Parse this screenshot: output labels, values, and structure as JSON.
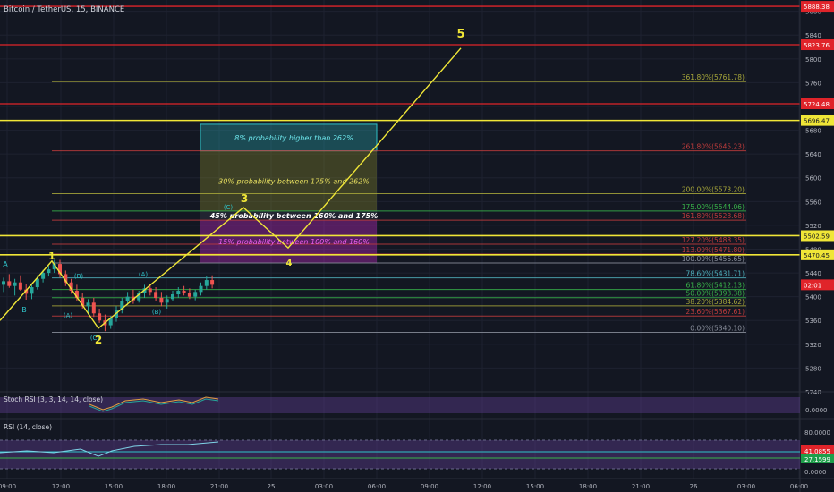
{
  "header": {
    "symbol_title": "Bitcoin / TetherUS, 15, BINANCE"
  },
  "colors": {
    "background": "#131722",
    "grid": "#1e2230",
    "yellow": "#f0e637",
    "red": "#e0242a",
    "green": "#35c25b",
    "candle_up": "#26a69a",
    "candle_down": "#ef5350",
    "magenta": "#d12bd1",
    "purple_band": "#3a2a5e",
    "cyan": "#2fc3c9",
    "olive": "#8b8b2b"
  },
  "chart_data": [
    {
      "type": "candlestick",
      "title": "Bitcoin / TetherUS, 15, BINANCE",
      "xlabel": "",
      "ylabel": "",
      "ylim": [
        5240,
        5890
      ],
      "x_ticks": [
        "09:00",
        "12:00",
        "15:00",
        "18:00",
        "21:00",
        "25",
        "03:00",
        "06:00",
        "09:00",
        "12:00",
        "15:00",
        "18:00",
        "21:00",
        "26",
        "03:00",
        "06:00"
      ],
      "y_ticks": [
        5240,
        5280,
        5320,
        5360,
        5400,
        5440,
        5480,
        5520,
        5560,
        5600,
        5640,
        5680,
        5720,
        5760,
        5800,
        5840,
        5880
      ],
      "price_labels": [
        {
          "text": "5888.38",
          "value": 5888.38,
          "color": "red"
        },
        {
          "text": "5823.76",
          "value": 5823.76,
          "color": "red"
        },
        {
          "text": "5724.48",
          "value": 5724.48,
          "color": "red"
        },
        {
          "text": "5696.47",
          "value": 5696.47,
          "color": "yellow"
        },
        {
          "text": "5502.59",
          "value": 5502.59,
          "color": "yellow"
        },
        {
          "text": "5470.45",
          "value": 5470.45,
          "color": "yellow"
        },
        {
          "text": "02:01",
          "value": 5420,
          "color": "red"
        }
      ],
      "horizontal_lines": [
        {
          "value": 5888.38,
          "color": "red"
        },
        {
          "value": 5823.76,
          "color": "red"
        },
        {
          "value": 5724.48,
          "color": "red"
        },
        {
          "value": 5696.47,
          "color": "yellow"
        },
        {
          "value": 5502.59,
          "color": "yellow"
        },
        {
          "value": 5470.45,
          "color": "yellow"
        }
      ],
      "fib_levels": [
        {
          "text": "361.80%(5761.78)",
          "value": 5761.78,
          "color": "#a7a73a"
        },
        {
          "text": "261.80%(5645.23)",
          "value": 5645.23,
          "color": "#c13c3c"
        },
        {
          "text": "200.00%(5573.20)",
          "value": 5573.2,
          "color": "#a7a73a"
        },
        {
          "text": "175.00%(5544.06)",
          "value": 5544.06,
          "color": "#39b54a"
        },
        {
          "text": "161.80%(5528.68)",
          "value": 5528.68,
          "color": "#c13c3c"
        },
        {
          "text": "127.20%(5488.35)",
          "value": 5488.35,
          "color": "#c13c3c"
        },
        {
          "text": "113.00%(5471.80)",
          "value": 5471.8,
          "color": "#c13c3c"
        },
        {
          "text": "100.00%(5456.65)",
          "value": 5456.65,
          "color": "#8a8f9c"
        },
        {
          "text": "78.60%(5431.71)",
          "value": 5431.71,
          "color": "#4fb3bf"
        },
        {
          "text": "61.80%(5412.13)",
          "value": 5412.13,
          "color": "#39b54a"
        },
        {
          "text": "50.00%(5398.38)",
          "value": 5398.38,
          "color": "#39b54a"
        },
        {
          "text": "38.20%(5384.62)",
          "value": 5384.62,
          "color": "#a7a73a"
        },
        {
          "text": "23.60%(5367.61)",
          "value": 5367.61,
          "color": "#c13c3c"
        },
        {
          "text": "0.00%(5340.10)",
          "value": 5340.1,
          "color": "#8a8f9c"
        }
      ],
      "probability_boxes": [
        {
          "text": "8% probability higher than 262%",
          "y_top": 5690,
          "y_bottom": 5645.23,
          "color": "cyan"
        },
        {
          "text": "30% probability between 175% and 262%",
          "y_top": 5645.23,
          "y_bottom": 5544.06,
          "color": "olive"
        },
        {
          "text": "45% probability between 160% and 175%",
          "y_top": 5544.06,
          "y_bottom": 5528.68,
          "color": "white"
        },
        {
          "text": "15% probability between 100% and 160%",
          "y_top": 5528.68,
          "y_bottom": 5456.65,
          "color": "magenta"
        }
      ],
      "wave_labels": [
        {
          "text": "1",
          "color": "yellow"
        },
        {
          "text": "2",
          "color": "yellow"
        },
        {
          "text": "3",
          "color": "yellow"
        },
        {
          "text": "4",
          "color": "yellow"
        },
        {
          "text": "5",
          "color": "yellow"
        },
        {
          "text": "A",
          "color": "cyan"
        },
        {
          "text": "B",
          "color": "cyan"
        },
        {
          "text": "(A)",
          "color": "cyan"
        },
        {
          "text": "(B)",
          "color": "cyan"
        },
        {
          "text": "(C)",
          "color": "cyan"
        },
        {
          "text": "(A)",
          "color": "cyan"
        },
        {
          "text": "(B)",
          "color": "cyan"
        },
        {
          "text": "(C)",
          "color": "cyan"
        }
      ],
      "candles": [
        {
          "o": 5420,
          "h": 5432,
          "l": 5408,
          "c": 5426
        },
        {
          "o": 5426,
          "h": 5438,
          "l": 5415,
          "c": 5418
        },
        {
          "o": 5418,
          "h": 5430,
          "l": 5402,
          "c": 5424
        },
        {
          "o": 5424,
          "h": 5436,
          "l": 5410,
          "c": 5412
        },
        {
          "o": 5412,
          "h": 5422,
          "l": 5395,
          "c": 5405
        },
        {
          "o": 5405,
          "h": 5420,
          "l": 5396,
          "c": 5416
        },
        {
          "o": 5416,
          "h": 5436,
          "l": 5412,
          "c": 5430
        },
        {
          "o": 5430,
          "h": 5445,
          "l": 5424,
          "c": 5440
        },
        {
          "o": 5440,
          "h": 5452,
          "l": 5434,
          "c": 5446
        },
        {
          "o": 5446,
          "h": 5462,
          "l": 5440,
          "c": 5455
        },
        {
          "o": 5455,
          "h": 5462,
          "l": 5432,
          "c": 5438
        },
        {
          "o": 5438,
          "h": 5444,
          "l": 5418,
          "c": 5424
        },
        {
          "o": 5424,
          "h": 5430,
          "l": 5405,
          "c": 5410
        },
        {
          "o": 5410,
          "h": 5420,
          "l": 5392,
          "c": 5398
        },
        {
          "o": 5398,
          "h": 5406,
          "l": 5380,
          "c": 5384
        },
        {
          "o": 5384,
          "h": 5396,
          "l": 5370,
          "c": 5390
        },
        {
          "o": 5390,
          "h": 5398,
          "l": 5366,
          "c": 5372
        },
        {
          "o": 5372,
          "h": 5380,
          "l": 5356,
          "c": 5360
        },
        {
          "o": 5360,
          "h": 5370,
          "l": 5342,
          "c": 5352
        },
        {
          "o": 5352,
          "h": 5368,
          "l": 5346,
          "c": 5364
        },
        {
          "o": 5364,
          "h": 5384,
          "l": 5358,
          "c": 5378
        },
        {
          "o": 5378,
          "h": 5398,
          "l": 5372,
          "c": 5392
        },
        {
          "o": 5392,
          "h": 5408,
          "l": 5386,
          "c": 5400
        },
        {
          "o": 5400,
          "h": 5412,
          "l": 5388,
          "c": 5394
        },
        {
          "o": 5394,
          "h": 5410,
          "l": 5390,
          "c": 5406
        },
        {
          "o": 5406,
          "h": 5420,
          "l": 5398,
          "c": 5414
        },
        {
          "o": 5414,
          "h": 5422,
          "l": 5402,
          "c": 5408
        },
        {
          "o": 5408,
          "h": 5416,
          "l": 5392,
          "c": 5398
        },
        {
          "o": 5398,
          "h": 5408,
          "l": 5384,
          "c": 5390
        },
        {
          "o": 5390,
          "h": 5402,
          "l": 5380,
          "c": 5396
        },
        {
          "o": 5396,
          "h": 5410,
          "l": 5392,
          "c": 5404
        },
        {
          "o": 5404,
          "h": 5416,
          "l": 5398,
          "c": 5410
        },
        {
          "o": 5410,
          "h": 5418,
          "l": 5402,
          "c": 5406
        },
        {
          "o": 5406,
          "h": 5414,
          "l": 5396,
          "c": 5400
        },
        {
          "o": 5400,
          "h": 5412,
          "l": 5394,
          "c": 5408
        },
        {
          "o": 5408,
          "h": 5424,
          "l": 5402,
          "c": 5418
        },
        {
          "o": 5418,
          "h": 5434,
          "l": 5412,
          "c": 5428
        },
        {
          "o": 5428,
          "h": 5436,
          "l": 5414,
          "c": 5420
        }
      ],
      "indicators": [
        {
          "name": "Stoch RSI (3, 3, 14, 14, close)",
          "value_label": "0.0000"
        },
        {
          "name": "RSI (14, close)",
          "value_labels": [
            "80.0000",
            "41.0855",
            "27.1599",
            "0.0000"
          ]
        }
      ]
    }
  ]
}
